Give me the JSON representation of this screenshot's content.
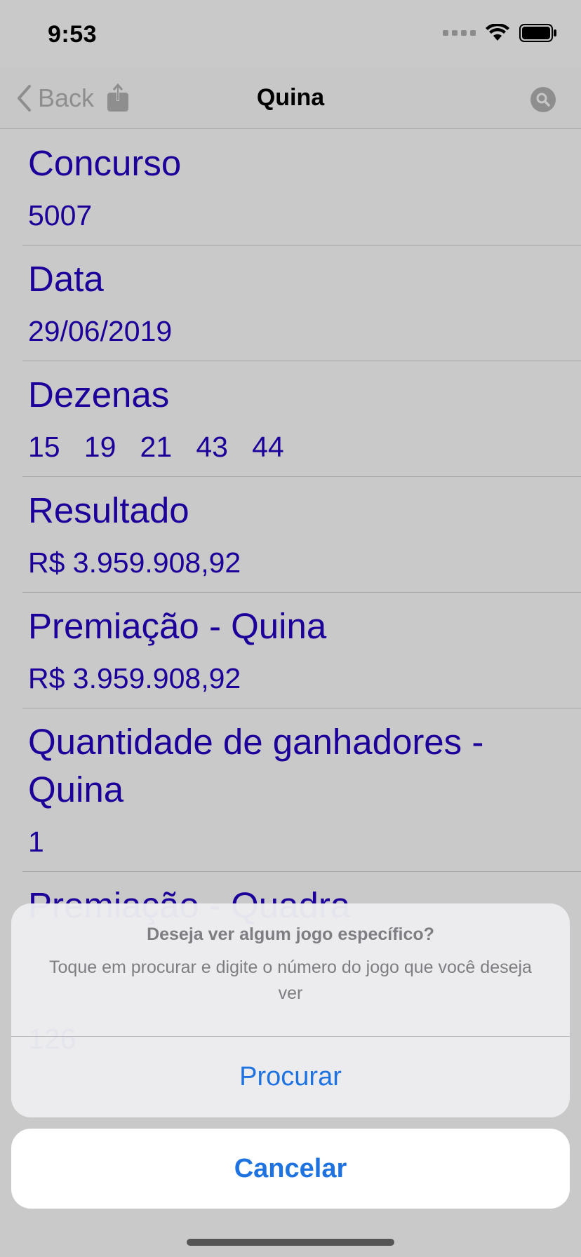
{
  "status_bar": {
    "time": "9:53"
  },
  "nav": {
    "back_label": "Back",
    "title": "Quina"
  },
  "rows": [
    {
      "label": "Concurso",
      "value": "5007"
    },
    {
      "label": "Data",
      "value": "29/06/2019"
    },
    {
      "label": "Dezenas",
      "value": "15   19   21   43   44"
    },
    {
      "label": "Resultado",
      "value": "R$ 3.959.908,92"
    },
    {
      "label": "Premiação - Quina",
      "value": "R$ 3.959.908,92"
    },
    {
      "label": "Quantidade de ganhadores - Quina",
      "value": "1"
    },
    {
      "label": "Premiação - Quadra",
      "value": ""
    },
    {
      "label": "",
      "value": "126"
    }
  ],
  "action_sheet": {
    "title": "Deseja ver algum jogo específico?",
    "message": "Toque em procurar e digite o número do jogo que você deseja ver",
    "action_label": "Procurar",
    "cancel_label": "Cancelar"
  },
  "colors": {
    "content_text": "#1c0099",
    "action_blue": "#1e73e0",
    "background": "#c9c9c9"
  }
}
